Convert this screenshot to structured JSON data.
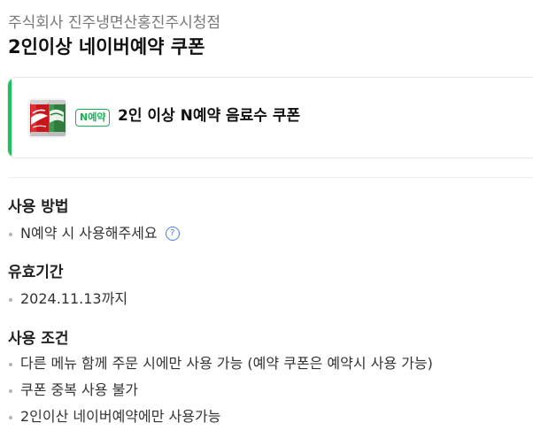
{
  "header": {
    "store_name": "주식회사 진주냉면산홍진주시청점",
    "coupon_title": "2인이상 네이버예약 쿠폰"
  },
  "coupon_card": {
    "badge": "N예약",
    "name": "2인 이상 N예약 음료수 쿠폰",
    "thumbnail_icon": "soda-cans-image",
    "accent_color": "#19c45b"
  },
  "usage": {
    "title": "사용 방법",
    "items": [
      "N예약 시 사용해주세요"
    ],
    "help_icon": "?"
  },
  "validity": {
    "title": "유효기간",
    "items": [
      "2024.11.13까지"
    ]
  },
  "conditions": {
    "title": "사용 조건",
    "items": [
      "다른 메뉴 함께 주문 시에만 사용 가능 (예약 쿠폰은 예약시 사용 가능)",
      "쿠폰 중복 사용 불가",
      "2인이산 네이버예약에만 사용가능"
    ]
  }
}
